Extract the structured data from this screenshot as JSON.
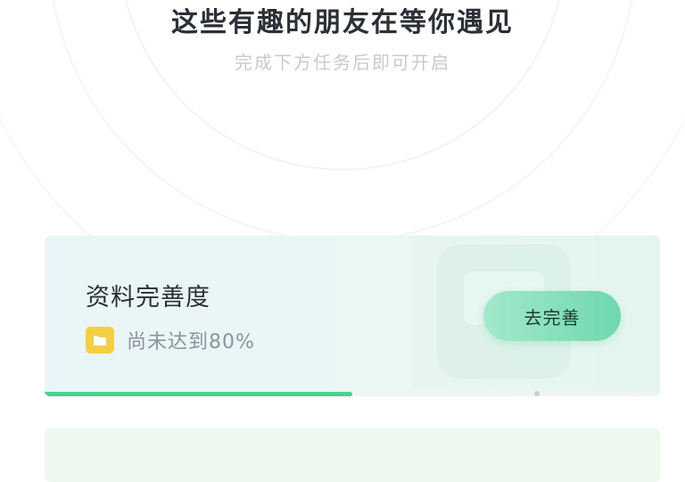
{
  "header": {
    "title": "这些有趣的朋友在等你遇见",
    "subtitle": "完成下方任务后即可开启"
  },
  "task": {
    "title": "资料完善度",
    "status_text": "尚未达到80%",
    "button_label": "去完善",
    "progress": 0.5,
    "target": 0.8
  },
  "colors": {
    "accent": "#4fcf94",
    "button_gradient_start": "#a3e9cd",
    "button_gradient_end": "#6fd7ad",
    "status_icon": "#f5cf42",
    "card_background": "#eaf5f7"
  },
  "icons": {
    "status": "folder-icon"
  }
}
